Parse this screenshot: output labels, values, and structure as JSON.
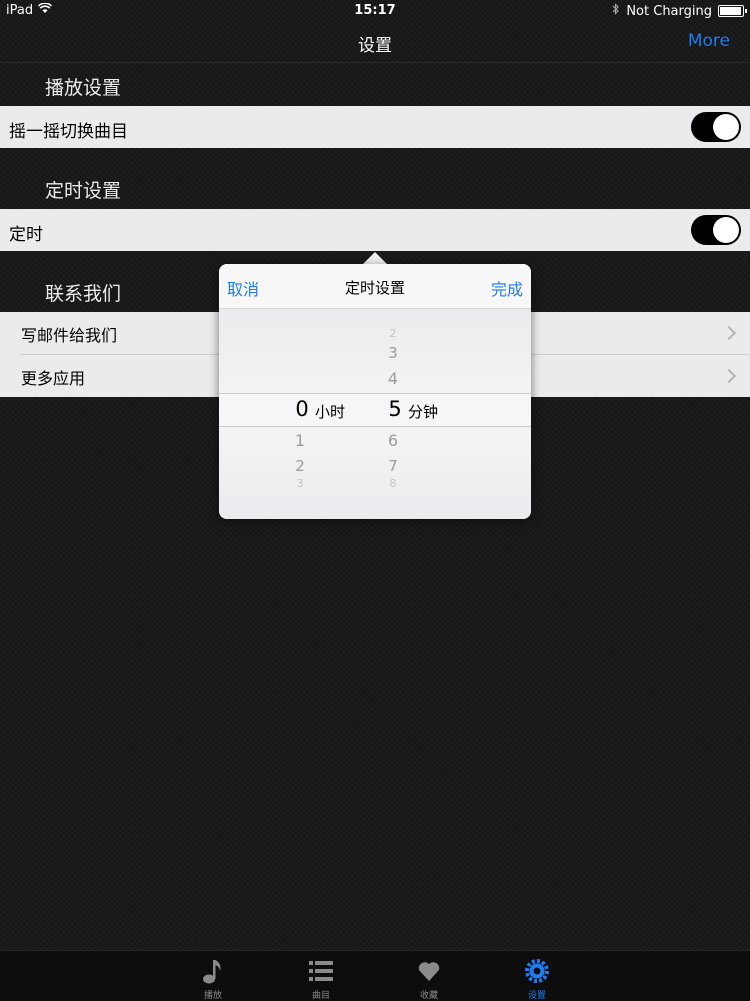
{
  "status_bar": {
    "device": "iPad",
    "time": "15:17",
    "charging": "Not Charging"
  },
  "nav": {
    "title": "设置",
    "more": "More"
  },
  "sections": {
    "playback": {
      "header": "播放设置",
      "shake_label": "摇一摇切换曲目",
      "shake_on": true
    },
    "timer": {
      "header": "定时设置",
      "timer_label": "定时",
      "timer_on": true
    },
    "contact": {
      "header": "联系我们",
      "items": [
        "写邮件给我们",
        "更多应用"
      ]
    }
  },
  "popover": {
    "cancel": "取消",
    "title": "定时设置",
    "done": "完成",
    "hours": {
      "above": [],
      "selected": "0",
      "unit": "小时",
      "below": [
        "1",
        "2",
        "3"
      ]
    },
    "minutes": {
      "above": [
        "2",
        "3",
        "4"
      ],
      "selected": "5",
      "unit": "分钟",
      "below": [
        "6",
        "7",
        "8"
      ]
    }
  },
  "tabs": [
    {
      "label": "播放",
      "icon": "music-note-icon",
      "active": false
    },
    {
      "label": "曲目",
      "icon": "list-icon",
      "active": false
    },
    {
      "label": "收藏",
      "icon": "heart-icon",
      "active": false
    },
    {
      "label": "设置",
      "icon": "gear-icon",
      "active": true
    }
  ],
  "colors": {
    "accent": "#1f7cf2",
    "background": "#161616",
    "cell": "#ebebed"
  }
}
